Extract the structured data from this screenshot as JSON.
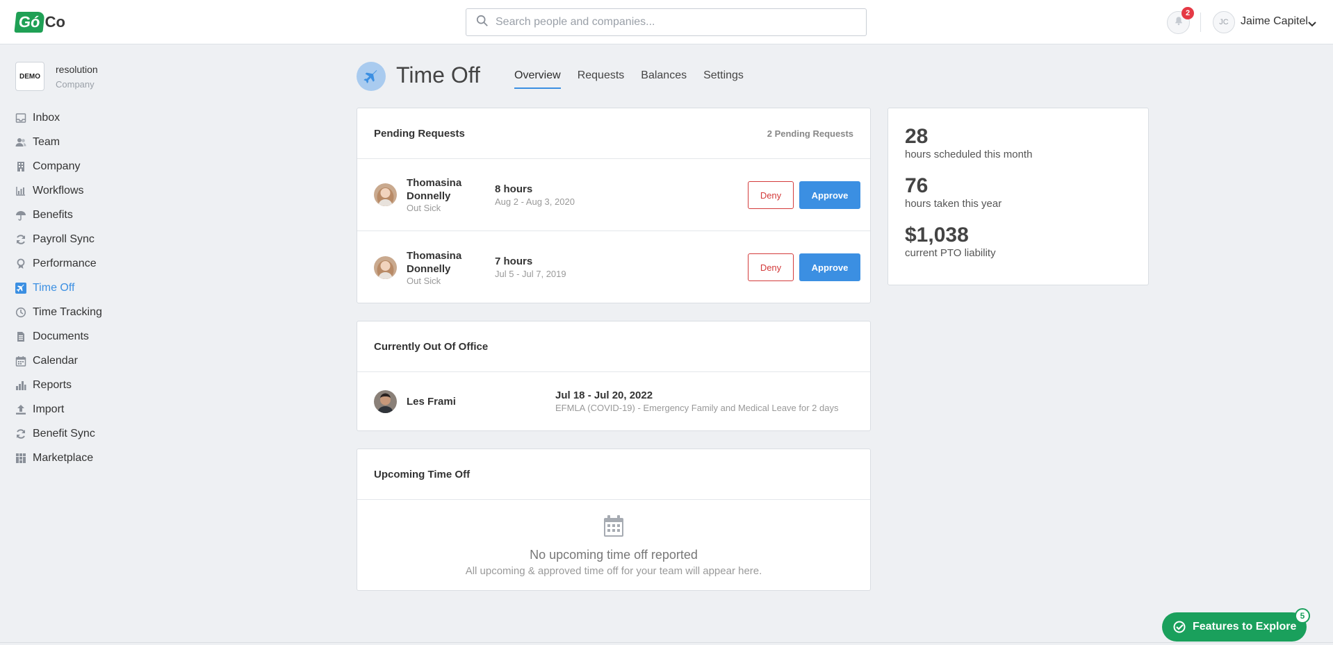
{
  "brand": {
    "logo_go": "Gó",
    "logo_co": "Co"
  },
  "header": {
    "search_placeholder": "Search people and companies...",
    "notification_count": "2",
    "user_initials": "JC",
    "user_name": "Jaime Capitel"
  },
  "company": {
    "badge": "DEMO",
    "name": "resolution",
    "type": "Company"
  },
  "sidebar": {
    "items": [
      {
        "label": "Inbox",
        "icon": "inbox-icon"
      },
      {
        "label": "Team",
        "icon": "team-icon"
      },
      {
        "label": "Company",
        "icon": "building-icon"
      },
      {
        "label": "Workflows",
        "icon": "workflows-icon"
      },
      {
        "label": "Benefits",
        "icon": "umbrella-icon"
      },
      {
        "label": "Payroll Sync",
        "icon": "sync-icon"
      },
      {
        "label": "Performance",
        "icon": "performance-icon"
      },
      {
        "label": "Time Off",
        "icon": "airplane-icon",
        "active": true
      },
      {
        "label": "Time Tracking",
        "icon": "clock-icon"
      },
      {
        "label": "Documents",
        "icon": "document-icon"
      },
      {
        "label": "Calendar",
        "icon": "calendar-icon"
      },
      {
        "label": "Reports",
        "icon": "bar-chart-icon"
      },
      {
        "label": "Import",
        "icon": "upload-icon"
      },
      {
        "label": "Benefit Sync",
        "icon": "sync-icon"
      },
      {
        "label": "Marketplace",
        "icon": "grid-icon"
      }
    ]
  },
  "page": {
    "title": "Time Off",
    "tabs": [
      "Overview",
      "Requests",
      "Balances",
      "Settings"
    ],
    "active_tab": "Overview"
  },
  "pending": {
    "title": "Pending Requests",
    "count_label": "2 Pending Requests",
    "deny_label": "Deny",
    "approve_label": "Approve",
    "requests": [
      {
        "first": "Thomasina",
        "last": "Donnelly",
        "type": "Out Sick",
        "hours": "8 hours",
        "dates": "Aug 2 - Aug 3, 2020"
      },
      {
        "first": "Thomasina",
        "last": "Donnelly",
        "type": "Out Sick",
        "hours": "7 hours",
        "dates": "Jul 5 - Jul 7, 2019"
      }
    ]
  },
  "out_of_office": {
    "title": "Currently Out Of Office",
    "name": "Les Frami",
    "dates": "Jul 18 - Jul 20, 2022",
    "reason": "EFMLA (COVID-19) - Emergency Family and Medical Leave for 2 days"
  },
  "upcoming": {
    "title": "Upcoming Time Off",
    "empty_title": "No upcoming time off reported",
    "empty_sub": "All upcoming & approved time off for your team will appear here."
  },
  "stats": [
    {
      "value": "28",
      "label": "hours scheduled this month"
    },
    {
      "value": "76",
      "label": "hours taken this year"
    },
    {
      "value": "$1,038",
      "label": "current PTO liability"
    }
  ],
  "explore": {
    "label": "Features to Explore",
    "count": "5"
  },
  "colors": {
    "accent": "#3b8fe2",
    "deny": "#d33a3a",
    "brand_green": "#1fa055"
  }
}
